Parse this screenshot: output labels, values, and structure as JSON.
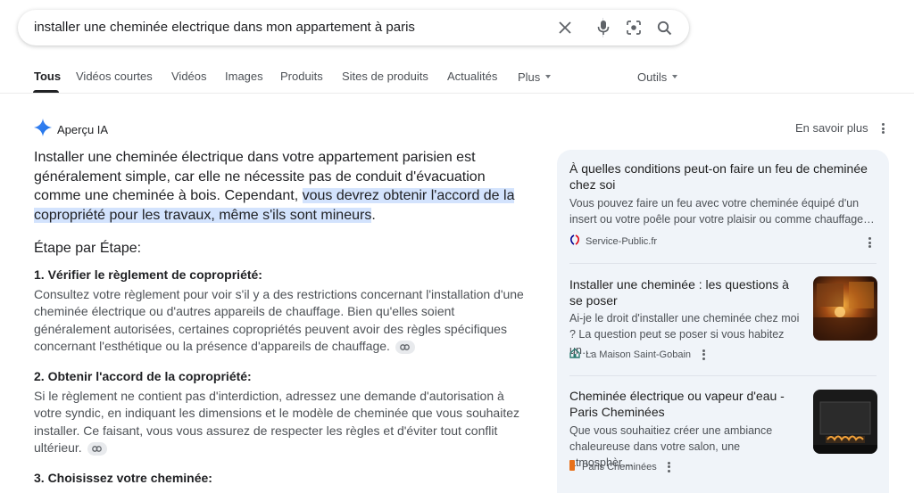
{
  "search": {
    "query": "installer une cheminée electrique dans mon appartement à paris"
  },
  "tabs": [
    {
      "label": "Tous",
      "active": true
    },
    {
      "label": "Vidéos courtes"
    },
    {
      "label": "Vidéos"
    },
    {
      "label": "Images"
    },
    {
      "label": "Produits"
    },
    {
      "label": "Sites de produits"
    },
    {
      "label": "Actualités"
    },
    {
      "label": "Plus"
    },
    {
      "label": "Outils"
    }
  ],
  "ai_overview": {
    "label": "Aperçu IA",
    "learn_more": "En savoir plus",
    "lead_plain": "Installer une cheminée électrique dans votre appartement parisien est généralement simple, car elle ne nécessite pas de conduit d'évacuation comme une cheminée à bois. Cependant, ",
    "lead_highlight": "vous devrez obtenir l'accord de la copropriété pour les travaux, même s'ils sont mineurs",
    "lead_end": ".",
    "steps_heading": "Étape par Étape:",
    "sections": [
      {
        "title": "1. Vérifier le règlement de copropriété:",
        "body": "Consultez votre règlement pour voir s'il y a des restrictions concernant l'installation d'une cheminée électrique ou d'autres appareils de chauffage. Bien qu'elles soient généralement autorisées, certaines copropriétés peuvent avoir des règles spécifiques concernant l'esthétique ou la présence d'appareils de chauffage."
      },
      {
        "title": "2. Obtenir l'accord de la copropriété:",
        "body": "Si le règlement ne contient pas d'interdiction, adressez une demande d'autorisation à votre syndic, en indiquant les dimensions et le modèle de cheminée que vous souhaitez installer. Ce faisant, vous vous assurez de respecter les règles et d'éviter tout conflit ultérieur."
      },
      {
        "title": "3. Choisissez votre cheminée:",
        "body": ""
      }
    ]
  },
  "sources": [
    {
      "title": "À quelles conditions peut-on faire un feu de cheminée chez soi",
      "snippet": "Vous pouvez faire un feu avec votre cheminée équipé d'un insert ou votre poêle pour votre plaisir ou comme chauffage…",
      "site": "Service-Public.fr",
      "icon": "marianne-icon"
    },
    {
      "title": "Installer une cheminée : les questions à se poser",
      "snippet": "Ai-je le droit d'installer une cheminée chez moi ? La question peut se poser si vous habitez un…",
      "site": "La Maison Saint-Gobain",
      "icon": "house-icon"
    },
    {
      "title": "Cheminée électrique ou vapeur d'eau - Paris Cheminées",
      "snippet": "Que vous souhaitiez créer une ambiance chaleureuse dans votre salon, une atmosphèr…",
      "site": "Paris Cheminées",
      "icon": "flame-icon"
    }
  ],
  "colors": {
    "accent": "#1a73e8",
    "highlight": "#d3e3fd",
    "panel": "#f0f4f9"
  }
}
